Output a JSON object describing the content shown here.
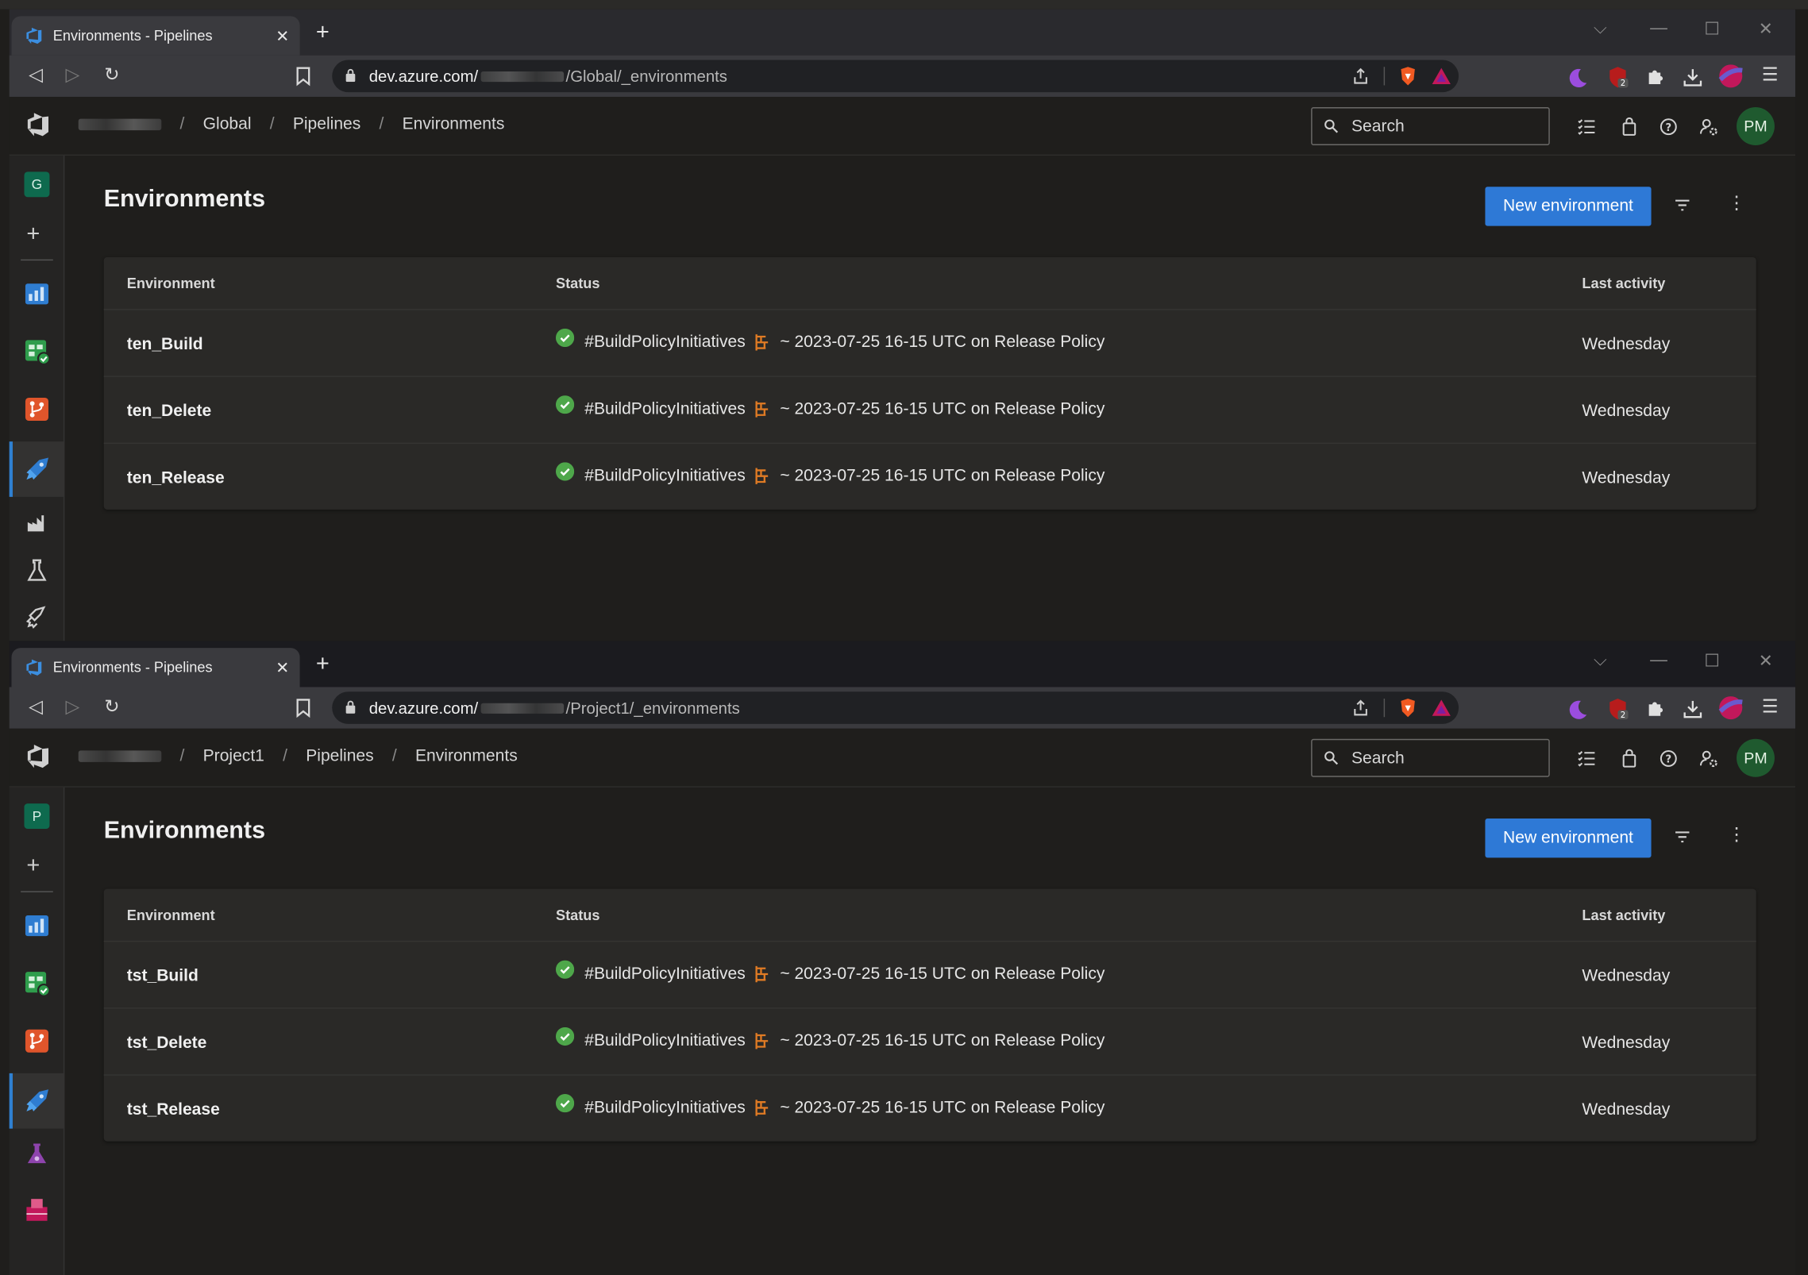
{
  "windows": [
    {
      "tab_title": "Environments - Pipelines",
      "url": {
        "host": "dev.azure.com/",
        "path": "/Global/_environments"
      },
      "breadcrumb": {
        "project": "Global",
        "section": "Pipelines",
        "page": "Environments"
      },
      "search_placeholder": "Search",
      "avatar": "PM",
      "project_initial": "G",
      "page_title": "Environments",
      "new_button": "New environment",
      "columns": {
        "environment": "Environment",
        "status": "Status",
        "last_activity": "Last activity"
      },
      "rows": [
        {
          "name": "ten_Build",
          "run": "#BuildPolicyInitiatives",
          "detail": "~ 2023-07-25 16-15 UTC on Release Policy",
          "last": "Wednesday"
        },
        {
          "name": "ten_Delete",
          "run": "#BuildPolicyInitiatives",
          "detail": "~ 2023-07-25 16-15 UTC on Release Policy",
          "last": "Wednesday"
        },
        {
          "name": "ten_Release",
          "run": "#BuildPolicyInitiatives",
          "detail": "~ 2023-07-25 16-15 UTC on Release Policy",
          "last": "Wednesday"
        }
      ]
    },
    {
      "tab_title": "Environments - Pipelines",
      "url": {
        "host": "dev.azure.com/",
        "path": "/Project1/_environments"
      },
      "breadcrumb": {
        "project": "Project1",
        "section": "Pipelines",
        "page": "Environments"
      },
      "search_placeholder": "Search",
      "avatar": "PM",
      "project_initial": "P",
      "page_title": "Environments",
      "new_button": "New environment",
      "columns": {
        "environment": "Environment",
        "status": "Status",
        "last_activity": "Last activity"
      },
      "rows": [
        {
          "name": "tst_Build",
          "run": "#BuildPolicyInitiatives",
          "detail": "~ 2023-07-25 16-15 UTC on Release Policy",
          "last": "Wednesday"
        },
        {
          "name": "tst_Delete",
          "run": "#BuildPolicyInitiatives",
          "detail": "~ 2023-07-25 16-15 UTC on Release Policy",
          "last": "Wednesday"
        },
        {
          "name": "tst_Release",
          "run": "#BuildPolicyInitiatives",
          "detail": "~ 2023-07-25 16-15 UTC on Release Policy",
          "last": "Wednesday"
        }
      ]
    }
  ],
  "colors": {
    "accent": "#2e79d6",
    "success": "#4ea74a",
    "avatar": "#1f5a2f"
  }
}
